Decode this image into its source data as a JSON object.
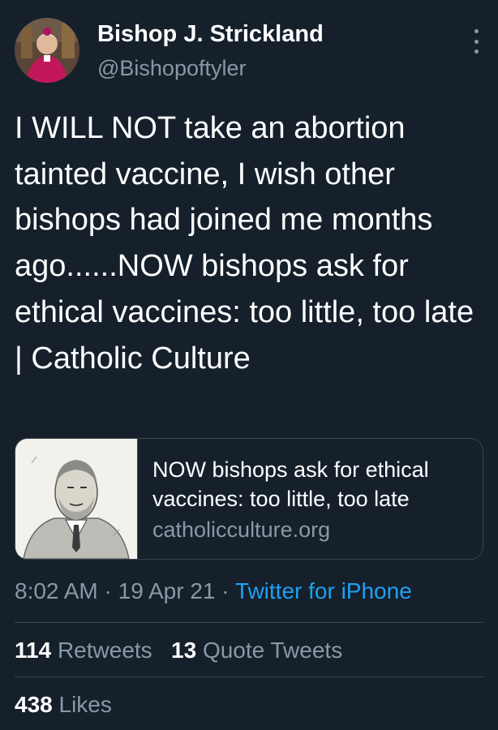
{
  "tweet": {
    "author": {
      "display_name": "Bishop J. Strickland",
      "handle": "@Bishopoftyler",
      "avatar_icon": "profile-photo"
    },
    "more_icon": "more-vertical-icon",
    "text": "I WILL NOT take an abortion tainted vaccine, I wish other bishops had joined me months ago......NOW bishops ask for ethical vaccines: too little, too late | Catholic Culture",
    "link_card": {
      "title": "NOW bishops ask for ethical vaccines: too little, too late",
      "domain": "catholicculture.org",
      "thumbnail_icon": "sketch-portrait-thumbnail"
    },
    "time": "8:02 AM",
    "date": "19 Apr 21",
    "separator": "·",
    "source": "Twitter for iPhone",
    "stats": {
      "retweets_count": "114",
      "retweets_label": "Retweets",
      "quotes_count": "13",
      "quotes_label": "Quote Tweets",
      "likes_count": "438",
      "likes_label": "Likes"
    }
  },
  "colors": {
    "background": "#15202b",
    "text_primary": "#ffffff",
    "text_secondary": "#8899a6",
    "link": "#1da1f2",
    "border": "#38444d"
  }
}
